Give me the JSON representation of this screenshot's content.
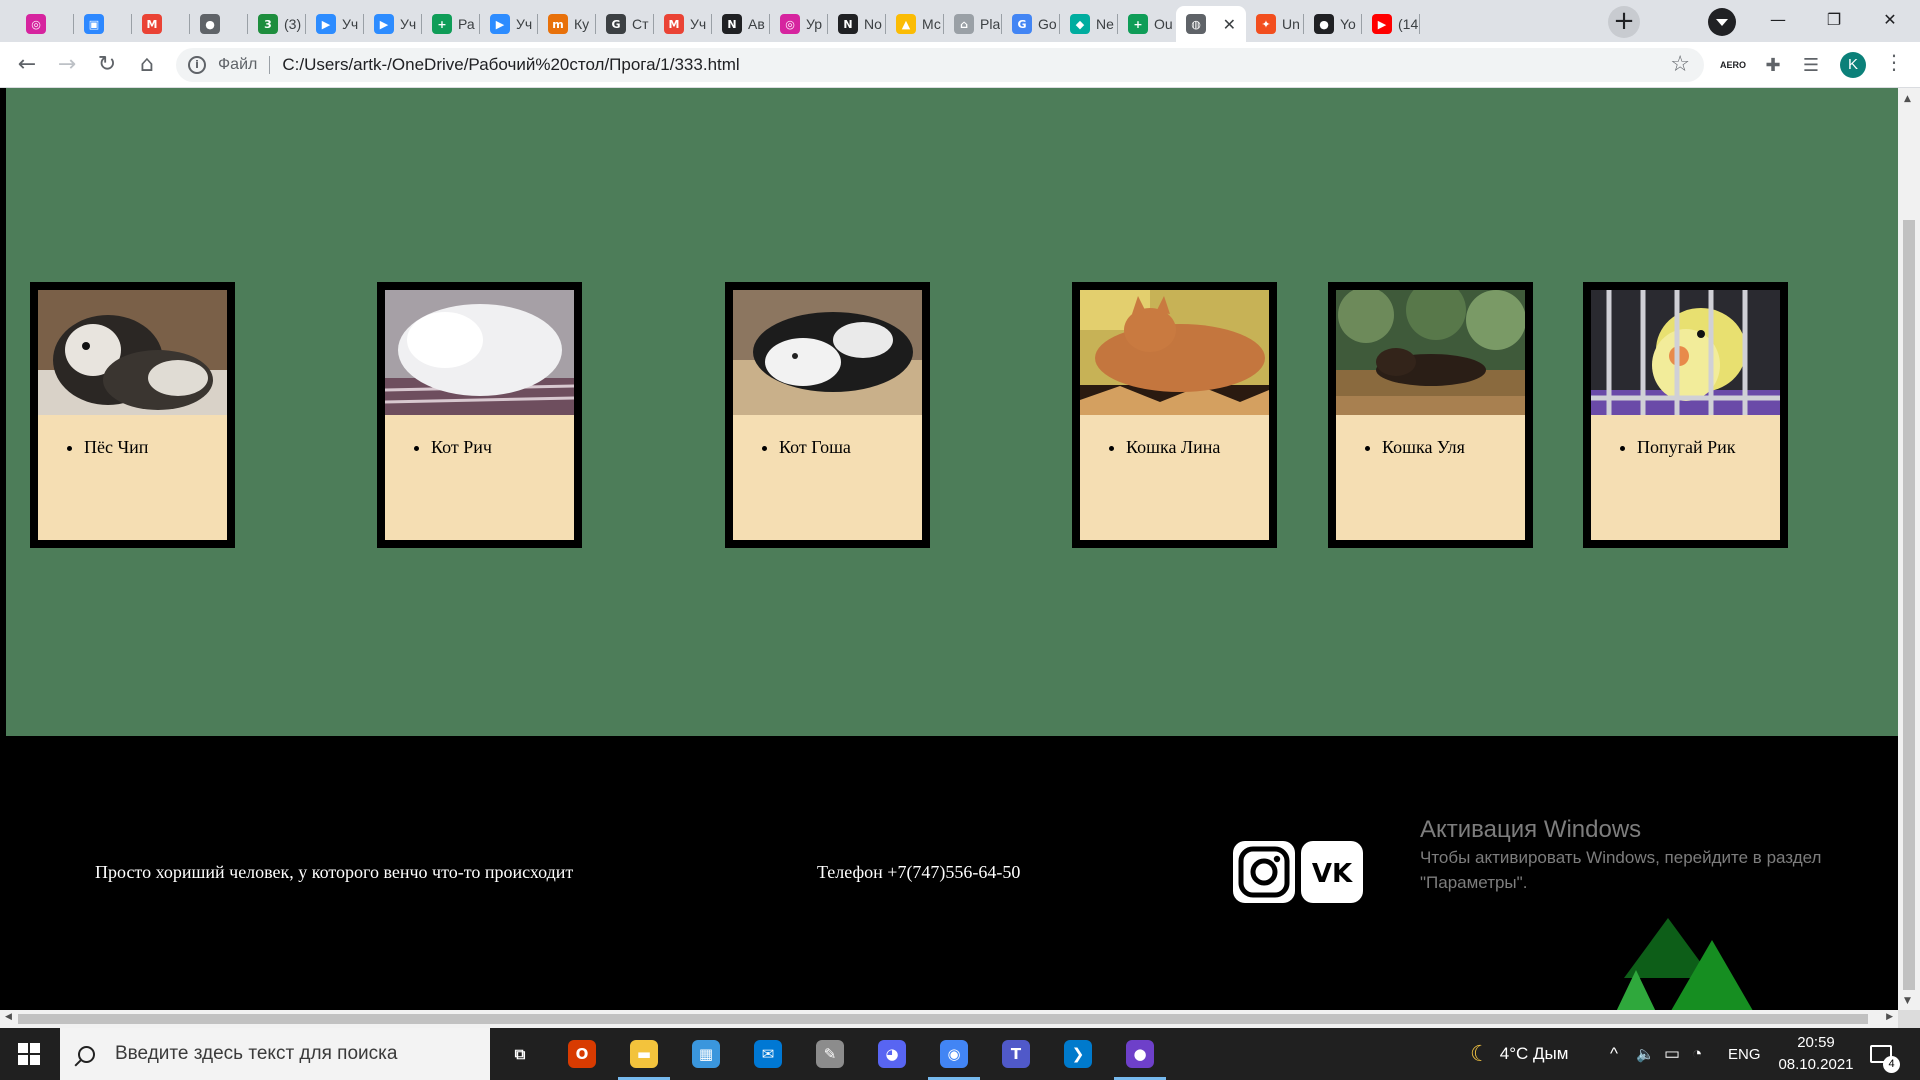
{
  "browser": {
    "tabs": [
      {
        "icon": "instagram-icon",
        "color": "#d6249f",
        "glyph": "◎",
        "label": ""
      },
      {
        "icon": "messenger-icon",
        "color": "#2d88ff",
        "glyph": "▣",
        "label": ""
      },
      {
        "icon": "gmail-icon",
        "color": "#ea4335",
        "glyph": "M",
        "label": ""
      },
      {
        "icon": "circle-icon",
        "color": "#5f6368",
        "glyph": "●",
        "label": ""
      },
      {
        "icon": "counter-icon",
        "color": "#1e8e3e",
        "glyph": "3",
        "label": "(3)"
      },
      {
        "icon": "zoom-icon",
        "color": "#2d8cff",
        "glyph": "▶",
        "label": "Уч"
      },
      {
        "icon": "zoom-icon",
        "color": "#2d8cff",
        "glyph": "▶",
        "label": "Уч"
      },
      {
        "icon": "sheets-icon",
        "color": "#0f9d58",
        "glyph": "+",
        "label": "Ра"
      },
      {
        "icon": "zoom-icon",
        "color": "#2d8cff",
        "glyph": "▶",
        "label": "Уч"
      },
      {
        "icon": "courses-icon",
        "color": "#e8710a",
        "glyph": "m",
        "label": "Ку"
      },
      {
        "icon": "gc-icon",
        "color": "#3c4043",
        "glyph": "G",
        "label": "Ст"
      },
      {
        "icon": "gmail-icon",
        "color": "#ea4335",
        "glyph": "M",
        "label": "Уч"
      },
      {
        "icon": "n-icon",
        "color": "#202124",
        "glyph": "N",
        "label": "Ав"
      },
      {
        "icon": "instagram-icon",
        "color": "#d6249f",
        "glyph": "◎",
        "label": "Ур"
      },
      {
        "icon": "notion-icon",
        "color": "#202124",
        "glyph": "N",
        "label": "No"
      },
      {
        "icon": "drive-icon",
        "color": "#fbbc04",
        "glyph": "▲",
        "label": "Мс"
      },
      {
        "icon": "bank-icon",
        "color": "#9aa0a6",
        "glyph": "⌂",
        "label": "Pla"
      },
      {
        "icon": "translate-icon",
        "color": "#4285f4",
        "glyph": "G",
        "label": "Go"
      },
      {
        "icon": "netlify-icon",
        "color": "#00ad9f",
        "glyph": "◆",
        "label": "Ne"
      },
      {
        "icon": "sheets-icon",
        "color": "#0f9d58",
        "glyph": "+",
        "label": "Ou"
      },
      {
        "icon": "globe-icon",
        "color": "#5f6368",
        "glyph": "◍",
        "label": "",
        "active": true
      },
      {
        "icon": "figma-icon",
        "color": "#f24e1e",
        "glyph": "✦",
        "label": "Un"
      },
      {
        "icon": "github-icon",
        "color": "#202124",
        "glyph": "●",
        "label": "Yo"
      },
      {
        "icon": "youtube-icon",
        "color": "#ff0000",
        "glyph": "▶",
        "label": "(14"
      }
    ],
    "new_tab_label": "+",
    "minimize": "—",
    "maximize": "❐",
    "close": "✕",
    "tab_close": "✕",
    "back": "←",
    "forward": "→",
    "reload": "↻",
    "home": "⌂",
    "info": "i",
    "file_label": "Файл",
    "url": "C:/Users/artk-/OneDrive/Рабочий%20стол/Прога/1/333.html",
    "star": "☆",
    "aero_label": "AERO",
    "profile_initial": "K",
    "menu": "⋮"
  },
  "page": {
    "hero_color": "#4d7d59",
    "cards": [
      {
        "name": "Пёс Чип",
        "photo": "dog"
      },
      {
        "name": "Кот Рич",
        "photo": "white-cat"
      },
      {
        "name": "Кот Гоша",
        "photo": "tuxedo-cat"
      },
      {
        "name": "Кошка Лина",
        "photo": "ginger-cat"
      },
      {
        "name": "Кошка Уля",
        "photo": "dark-cat"
      },
      {
        "name": "Попугай Рик",
        "photo": "parrot"
      }
    ],
    "footer": {
      "tagline": "Просто хориший человек, у которого венчо что-то происходит",
      "phone": "Телефон +7(747)556-64-50",
      "instagram_icon": "instagram-icon",
      "vk_icon": "vk-icon",
      "vk_label": "VK"
    }
  },
  "watermark": {
    "title": "Активация Windows",
    "subtitle": "Чтобы активировать Windows, перейдите в раздел \"Параметры\"."
  },
  "taskbar": {
    "search_placeholder": "Введите здесь текст для поиска",
    "apps": [
      {
        "icon": "task-view-icon",
        "color": "#202020",
        "glyph": "⧉"
      },
      {
        "icon": "office-icon",
        "color": "#d83b01",
        "glyph": "O"
      },
      {
        "icon": "file-explorer-icon",
        "color": "#f3c33c",
        "glyph": "▬"
      },
      {
        "icon": "store-icon",
        "color": "#3a96dd",
        "glyph": "▦"
      },
      {
        "icon": "mail-icon",
        "color": "#0078d4",
        "glyph": "✉"
      },
      {
        "icon": "paint-icon",
        "color": "#8c8c8c",
        "glyph": "✎"
      },
      {
        "icon": "discord-icon",
        "color": "#5865f2",
        "glyph": "◕"
      },
      {
        "icon": "chrome-icon",
        "color": "#4285f4",
        "glyph": "◉"
      },
      {
        "icon": "teams-icon",
        "color": "#5059c9",
        "glyph": "T"
      },
      {
        "icon": "vscode-icon",
        "color": "#007acc",
        "glyph": "❯"
      },
      {
        "icon": "github-desktop-icon",
        "color": "#6e40c9",
        "glyph": "●"
      }
    ],
    "weather": "4°C Дым",
    "tray_chevron": "^",
    "volume": "🔈",
    "battery": "▭",
    "wifi": "◔",
    "lang": "ENG",
    "time": "20:59",
    "date": "08.10.2021",
    "notif_count": "4"
  }
}
